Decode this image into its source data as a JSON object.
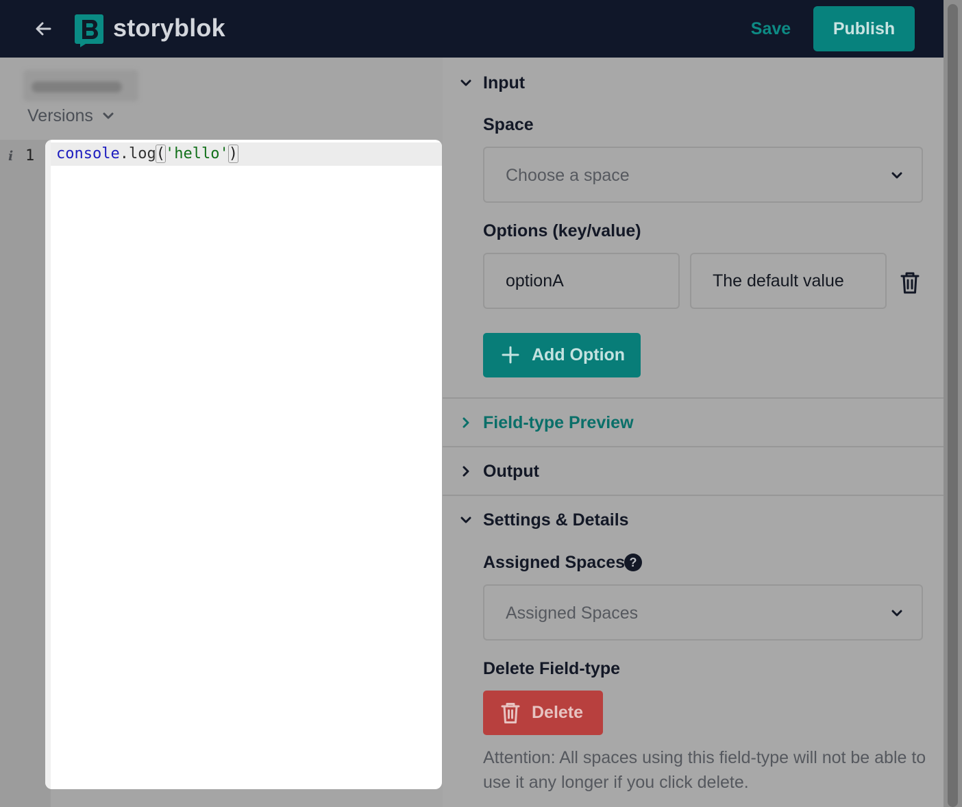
{
  "topbar": {
    "brand": "storyblok",
    "save_label": "Save",
    "publish_label": "Publish"
  },
  "left": {
    "versions_label": "Versions",
    "gutter_marker": "i",
    "line_number": "1",
    "code": {
      "var": "console",
      "dot": ".",
      "prop": "log",
      "open": "(",
      "str": "'hello'",
      "close": ")"
    }
  },
  "sections": {
    "input": {
      "title": "Input",
      "space_label": "Space",
      "space_placeholder": "Choose a space",
      "options_label": "Options (key/value)",
      "option_key": "optionA",
      "option_value": "The default value",
      "add_option_label": "Add Option"
    },
    "preview": {
      "title": "Field-type Preview"
    },
    "output": {
      "title": "Output"
    },
    "settings": {
      "title": "Settings & Details",
      "assigned_label": "Assigned Spaces",
      "assigned_placeholder": "Assigned Spaces",
      "help_glyph": "?",
      "delete_section_label": "Delete Field-type",
      "delete_button_label": "Delete",
      "attention_text": "Attention: All spaces using this field-type will not be able to use it any longer if you click delete."
    }
  },
  "colors": {
    "topbar_bg": "#101729",
    "brand_teal": "#07827d",
    "danger": "#b8403e",
    "overlay_gray": "#a5a5a5"
  },
  "icons": [
    "back-arrow-icon",
    "storyblok-logo-icon",
    "chevron-down-icon",
    "chevron-right-icon",
    "trash-icon",
    "plus-icon",
    "help-icon"
  ]
}
